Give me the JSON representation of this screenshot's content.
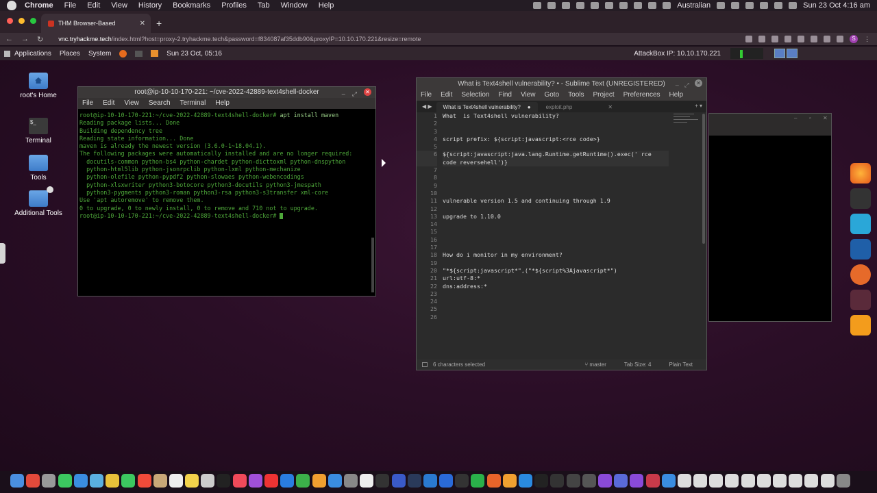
{
  "mac_menubar": {
    "app_name": "Chrome",
    "items": [
      "File",
      "Edit",
      "View",
      "History",
      "Bookmarks",
      "Profiles",
      "Tab",
      "Window",
      "Help"
    ],
    "input_source": "Australian",
    "datetime": "Sun 23 Oct  4:16 am"
  },
  "browser": {
    "tab_title": "THM Browser-Based",
    "url_host": "vnc.tryhackme.tech",
    "url_rest": "/index.html?host=proxy-2.tryhackme.tech&password=f834087af35ddb90&proxyIP=10.10.170.221&resize=remote",
    "profile_initial": "S"
  },
  "gnome_panel": {
    "menus": [
      "Applications",
      "Places",
      "System"
    ],
    "datetime": "Sun 23 Oct, 05:16",
    "attackbox_label": "AttackBox IP:",
    "attackbox_ip": "10.10.170.221"
  },
  "desktop_icons": [
    {
      "label": "root's Home"
    },
    {
      "label": "Terminal"
    },
    {
      "label": "Tools"
    },
    {
      "label": "Additional Tools"
    }
  ],
  "terminal": {
    "title": "root@ip-10-10-170-221: ~/cve-2022-42889-text4shell-docker",
    "menu": [
      "File",
      "Edit",
      "View",
      "Search",
      "Terminal",
      "Help"
    ],
    "prompt": "root@ip-10-10-170-221:~/cve-2022-42889-text4shell-docker#",
    "command": " apt install maven",
    "lines": [
      "Reading package lists... Done",
      "Building dependency tree",
      "Reading state information... Done",
      "maven is already the newest version (3.6.0-1~18.04.1).",
      "The following packages were automatically installed and are no longer required:",
      "  docutils-common python-bs4 python-chardet python-dicttoxml python-dnspython",
      "  python-html5lib python-jsonrpclib python-lxml python-mechanize",
      "  python-olefile python-pypdf2 python-slowaes python-webencodings",
      "  python-xlsxwriter python3-botocore python3-docutils python3-jmespath",
      "  python3-pygments python3-roman python3-rsa python3-s3transfer xml-core",
      "Use 'apt autoremove' to remove them.",
      "0 to upgrade, 0 to newly install, 0 to remove and 710 not to upgrade."
    ]
  },
  "sublime": {
    "title": "What is Text4shell vulnerability? • - Sublime Text (UNREGISTERED)",
    "menu": [
      "File",
      "Edit",
      "Selection",
      "Find",
      "View",
      "Goto",
      "Tools",
      "Project",
      "Preferences",
      "Help"
    ],
    "tab_active": "What is Text4shell vulnerability?",
    "tab_other": "exploit.php",
    "status_left": "6 characters selected",
    "status_branch": "master",
    "status_tab": "Tab Size: 4",
    "status_syntax": "Plain Text",
    "lines": [
      "What  is Text4shell vulnerability?",
      "",
      "",
      "script prefix: ${script:javascript:<rce code>}",
      "",
      "${script:javascript:java.lang.Runtime.getRuntime().exec(' rce",
      "code reversehell')}",
      "",
      "",
      "",
      "",
      "vulnerable version 1.5 and continuing through 1.9",
      "",
      "upgrade to 1.10.0",
      "",
      "",
      "",
      "",
      "How do i monitor in my environment?",
      "",
      "\"*${script:javascript*\",(\"*${script%3Ajavascript*\")",
      "url:utf-8:*",
      "dns:address:*",
      "",
      "",
      ""
    ],
    "line_numbers": [
      "1",
      "2",
      "3",
      "4",
      "5",
      "6",
      "",
      "7",
      "8",
      "9",
      "10",
      "11",
      "12",
      "13",
      "14",
      "15",
      "16",
      "17",
      "18",
      "19",
      "20",
      "21",
      "22",
      "23",
      "24",
      "25",
      "26"
    ]
  },
  "colors": {
    "terminal_green": "#4ea83a",
    "desktop_bg": "#2a0e26",
    "close_red": "#d44"
  }
}
